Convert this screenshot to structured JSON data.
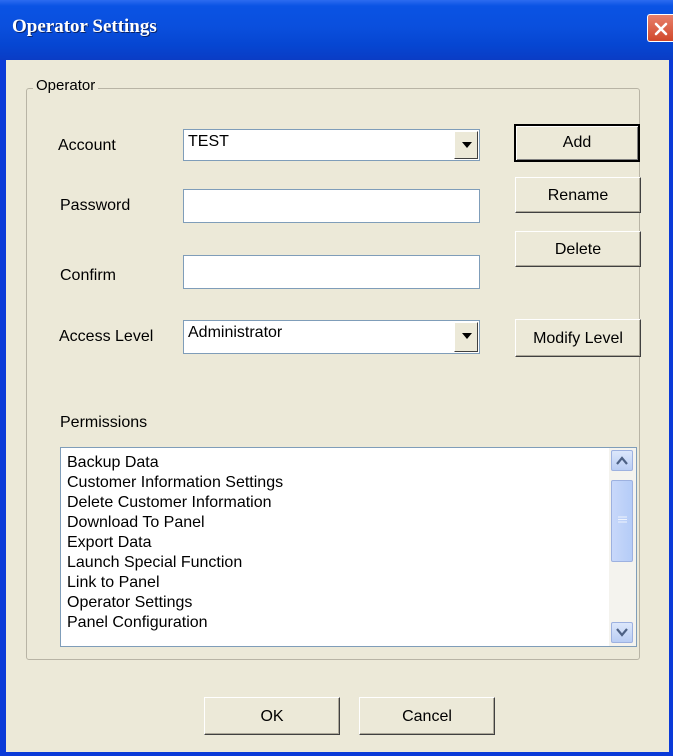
{
  "window": {
    "title": "Operator Settings"
  },
  "group": {
    "label": "Operator"
  },
  "fields": {
    "account_label": "Account",
    "account_value": "TEST",
    "password_label": "Password",
    "password_value": "",
    "confirm_label": "Confirm",
    "confirm_value": "",
    "access_level_label": "Access Level",
    "access_level_value": "Administrator"
  },
  "buttons": {
    "add": "Add",
    "rename": "Rename",
    "delete": "Delete",
    "modify_level": "Modify Level",
    "ok": "OK",
    "cancel": "Cancel"
  },
  "permissions": {
    "label": "Permissions",
    "items": [
      "Backup Data",
      "Customer Information Settings",
      "Delete Customer Information",
      "Download To Panel",
      "Export Data",
      "Launch Special Function",
      "Link to Panel",
      "Operator Settings",
      "Panel Configuration"
    ]
  },
  "icons": {
    "close": "close-icon",
    "dropdown": "chevron-down-icon",
    "scroll_up": "scroll-up-icon",
    "scroll_down": "scroll-down-icon"
  },
  "colors": {
    "titlebar": "#0A4FDD",
    "dialog_bg": "#ECE9D8",
    "close_button": "#D0482B"
  }
}
